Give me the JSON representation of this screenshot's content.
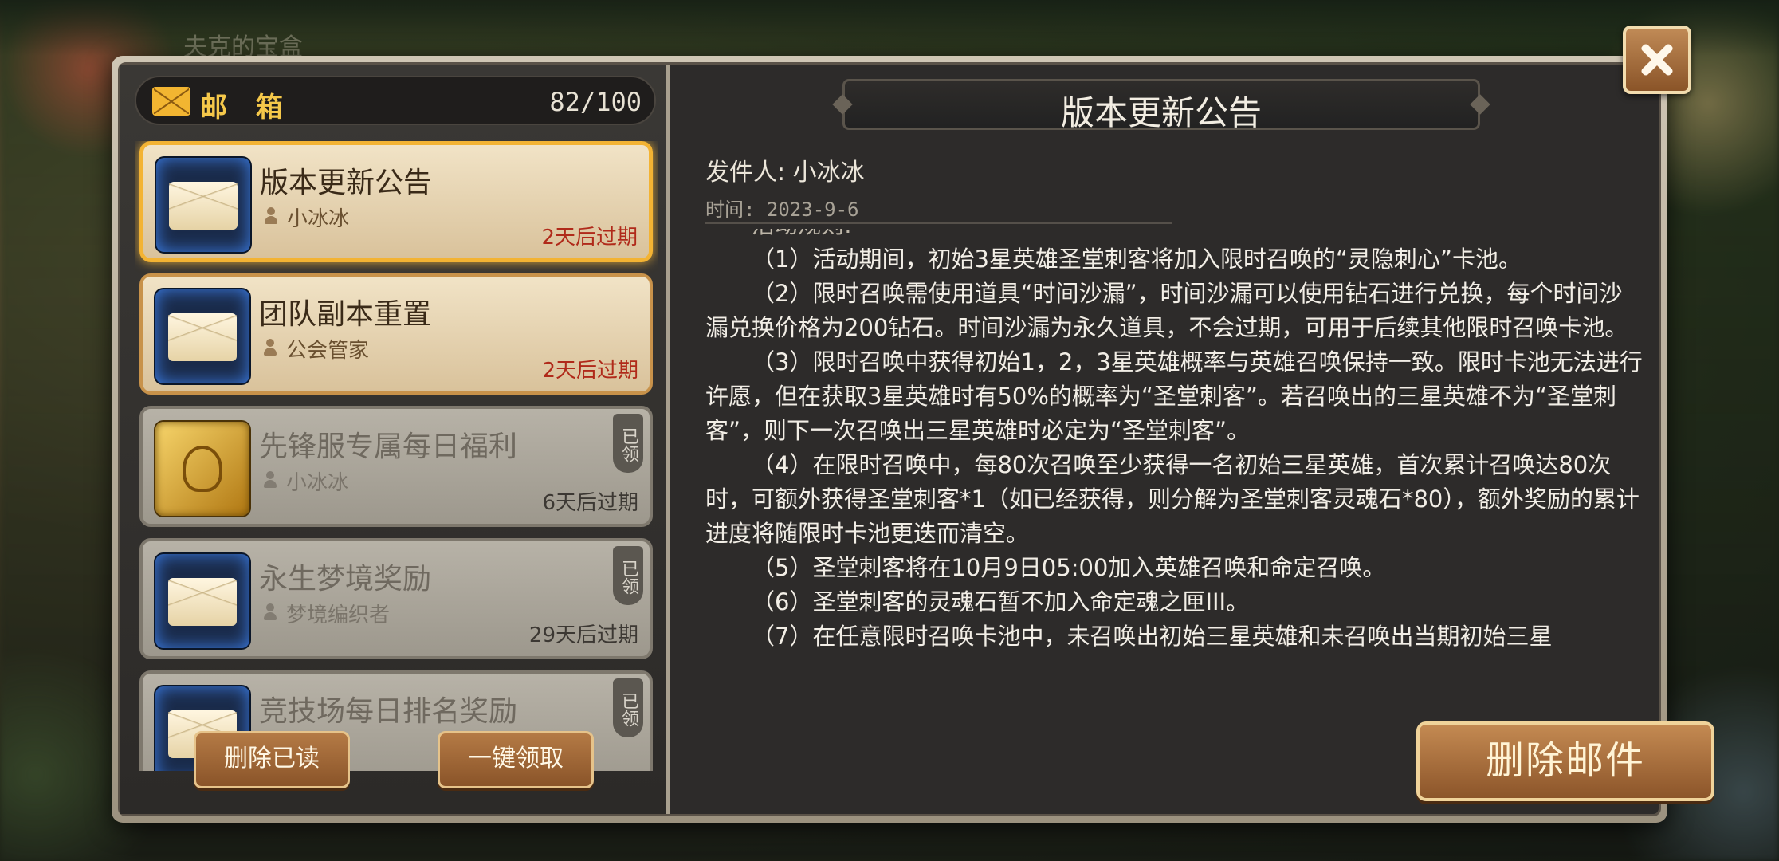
{
  "mailbox": {
    "title": "邮 箱",
    "count": "82/100",
    "items": [
      {
        "title": "版本更新公告",
        "sender": "小冰冰",
        "expire": "2天后过期",
        "state": "unread",
        "selected": true
      },
      {
        "title": "团队副本重置",
        "sender": "公会管家",
        "expire": "2天后过期",
        "state": "unread"
      },
      {
        "title": "先锋服专属每日福利",
        "sender": "小冰冰",
        "expire": "6天后过期",
        "state": "read",
        "badge": "已领"
      },
      {
        "title": "永生梦境奖励",
        "sender": "梦境编织者",
        "expire": "29天后过期",
        "state": "read",
        "badge": "已领"
      },
      {
        "title": "竞技场每日排名奖励",
        "state": "read",
        "badge": "已领"
      }
    ],
    "delete_read_label": "删除已读",
    "claim_all_label": "一键领取"
  },
  "detail": {
    "title": "版本更新公告",
    "from": "发件人: 小冰冰",
    "time": "时间: 2023-9-6",
    "cut_line": "活动规则:",
    "paragraphs": [
      "（1）活动期间，初始3星英雄圣堂刺客将加入限时召唤的“灵隐刺心”卡池。",
      "（2）限时召唤需使用道具“时间沙漏”，时间沙漏可以使用钻石进行兑换，每个时间沙漏兑换价格为200钻石。时间沙漏为永久道具，不会过期，可用于后续其他限时召唤卡池。",
      "（3）限时召唤中获得初始1，2，3星英雄概率与英雄召唤保持一致。限时卡池无法进行许愿，但在获取3星英雄时有50%的概率为“圣堂刺客”。若召唤出的三星英雄不为“圣堂刺客”，则下一次召唤出三星英雄时必定为“圣堂刺客”。",
      "（4）在限时召唤中，每80次召唤至少获得一名初始三星英雄，首次累计召唤达80次时，可额外获得圣堂刺客*1（如已经获得，则分解为圣堂刺客灵魂石*80），额外奖励的累计进度将随限时卡池更迭而清空。",
      "（5）圣堂刺客将在10月9日05:00加入英雄召唤和命定召唤。",
      "（6）圣堂刺客的灵魂石暂不加入命定魂之匣III。",
      "（7）在任意限时召唤卡池中，未召唤出初始三星英雄和未召唤出当期初始三星"
    ],
    "delete_mail_label": "删除邮件"
  },
  "background": {
    "faint_text": "夫克的宝盒"
  },
  "colors": {
    "accent_gold": "#f3b333",
    "expire_red": "#b02a1a",
    "button_brown": "#8a5429"
  }
}
